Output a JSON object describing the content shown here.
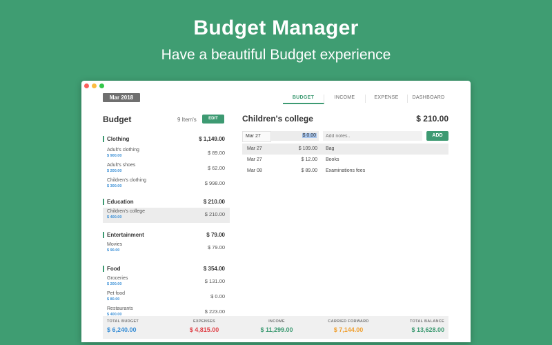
{
  "promo": {
    "title": "Budget Manager",
    "subtitle": "Have a beautiful Budget experience"
  },
  "header": {
    "month": "Mar 2018",
    "tabs": [
      {
        "label": "BUDGET",
        "active": true
      },
      {
        "label": "INCOME",
        "active": false
      },
      {
        "label": "EXPENSE",
        "active": false
      },
      {
        "label": "DASHBOARD",
        "active": false
      }
    ]
  },
  "budget": {
    "heading": "Budget",
    "items_count": "9 Item's",
    "edit_label": "EDIT",
    "categories": [
      {
        "name": "Clothing",
        "total": "$ 1,149.00",
        "items": [
          {
            "name": "Adult's clothing",
            "budget": "$ 900.00",
            "amount": "$ 89.00"
          },
          {
            "name": "Adult's shoes",
            "budget": "$ 200.00",
            "amount": "$ 62.00"
          },
          {
            "name": "Children's clothing",
            "budget": "$ 300.00",
            "amount": "$ 998.00"
          }
        ]
      },
      {
        "name": "Education",
        "total": "$ 210.00",
        "items": [
          {
            "name": "Children's college",
            "budget": "$ 400.00",
            "amount": "$ 210.00",
            "selected": true
          }
        ]
      },
      {
        "name": "Entertainment",
        "total": "$ 79.00",
        "items": [
          {
            "name": "Movies",
            "budget": "$ 90.00",
            "amount": "$ 79.00"
          }
        ]
      },
      {
        "name": "Food",
        "total": "$ 354.00",
        "items": [
          {
            "name": "Groceries",
            "budget": "$ 200.00",
            "amount": "$ 131.00"
          },
          {
            "name": "Pet food",
            "budget": "$ 80.00",
            "amount": "$ 0.00"
          },
          {
            "name": "Restaurants",
            "budget": "$ 400.00",
            "amount": "$ 223.00"
          }
        ]
      }
    ]
  },
  "detail": {
    "title": "Children's college",
    "total": "$ 210.00",
    "new_entry": {
      "date": "Mar 27",
      "amount": "$ 0.00",
      "notes_placeholder": "Add notes..",
      "add_label": "ADD"
    },
    "entries": [
      {
        "date": "Mar 27",
        "amount": "$ 109.00",
        "note": "Bag",
        "selected": true
      },
      {
        "date": "Mar 27",
        "amount": "$ 12.00",
        "note": "Books"
      },
      {
        "date": "Mar 08",
        "amount": "$ 89.00",
        "note": "Examinations fees"
      }
    ]
  },
  "footer": {
    "total_budget": {
      "label": "TOTAL BUDGET",
      "value": "$ 6,240.00",
      "color": "#3a8fd6"
    },
    "expenses": {
      "label": "EXPENSES",
      "value": "$ 4,815.00",
      "color": "#e0454b"
    },
    "income": {
      "label": "INCOME",
      "value": "$ 11,299.00",
      "color": "#3d9a72"
    },
    "carried_forward": {
      "label": "CARRIED FORWARD",
      "value": "$ 7,144.00",
      "color": "#f0a030"
    },
    "total_balance": {
      "label": "TOTAL BALANCE",
      "value": "$ 13,628.00",
      "color": "#3d9a72"
    }
  }
}
